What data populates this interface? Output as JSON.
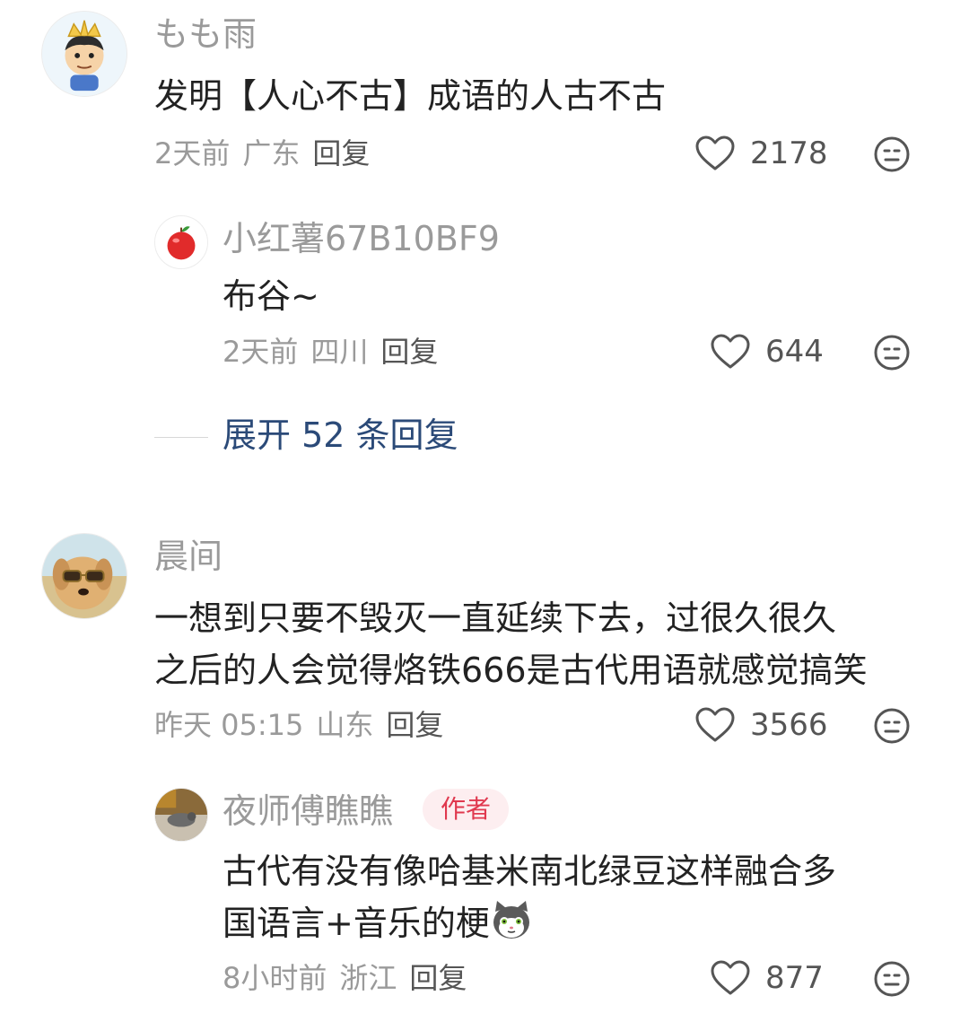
{
  "comments": [
    {
      "username": "もも雨",
      "content_lines": [
        "发明【人心不古】成语的人古不古"
      ],
      "time": "2天前",
      "location": "广东",
      "reply_label": "回复",
      "likes": "2178",
      "avatar_icon": "crowned-boy-avatar-icon"
    },
    {
      "username": "小红薯67B10BF9",
      "content_lines": [
        "布谷~"
      ],
      "time": "2天前",
      "location": "四川",
      "reply_label": "回复",
      "likes": "644",
      "avatar_icon": "apple-avatar-icon"
    },
    {
      "username": "晨间",
      "content_lines": [
        "一想到只要不毁灭一直延续下去，过很久很久",
        "之后的人会觉得烙铁666是古代用语就感觉搞笑"
      ],
      "time": "昨天 05:15",
      "location": "山东",
      "reply_label": "回复",
      "likes": "3566",
      "avatar_icon": "dog-with-sunglasses-avatar-icon"
    },
    {
      "username": "夜师傅瞧瞧",
      "badge": "作者",
      "content_lines": [
        "古代有没有像哈基米南北绿豆这样融合多",
        "国语言+音乐的梗"
      ],
      "time": "8小时前",
      "location": "浙江",
      "reply_label": "回复",
      "likes": "877",
      "avatar_icon": "bird-photo-avatar-icon"
    }
  ],
  "expand_replies": "展开 52 条回复",
  "icons": {
    "like": "heart-outline-icon",
    "dislike": "unamused-face-icon",
    "inline_emoji": "gray-cat-emoji-icon"
  },
  "colors": {
    "text_primary": "#222222",
    "text_secondary": "#9a9a9a",
    "link_blue": "#2b4a78",
    "author_badge_text": "#e0384e",
    "author_badge_bg": "#fdeef0"
  }
}
